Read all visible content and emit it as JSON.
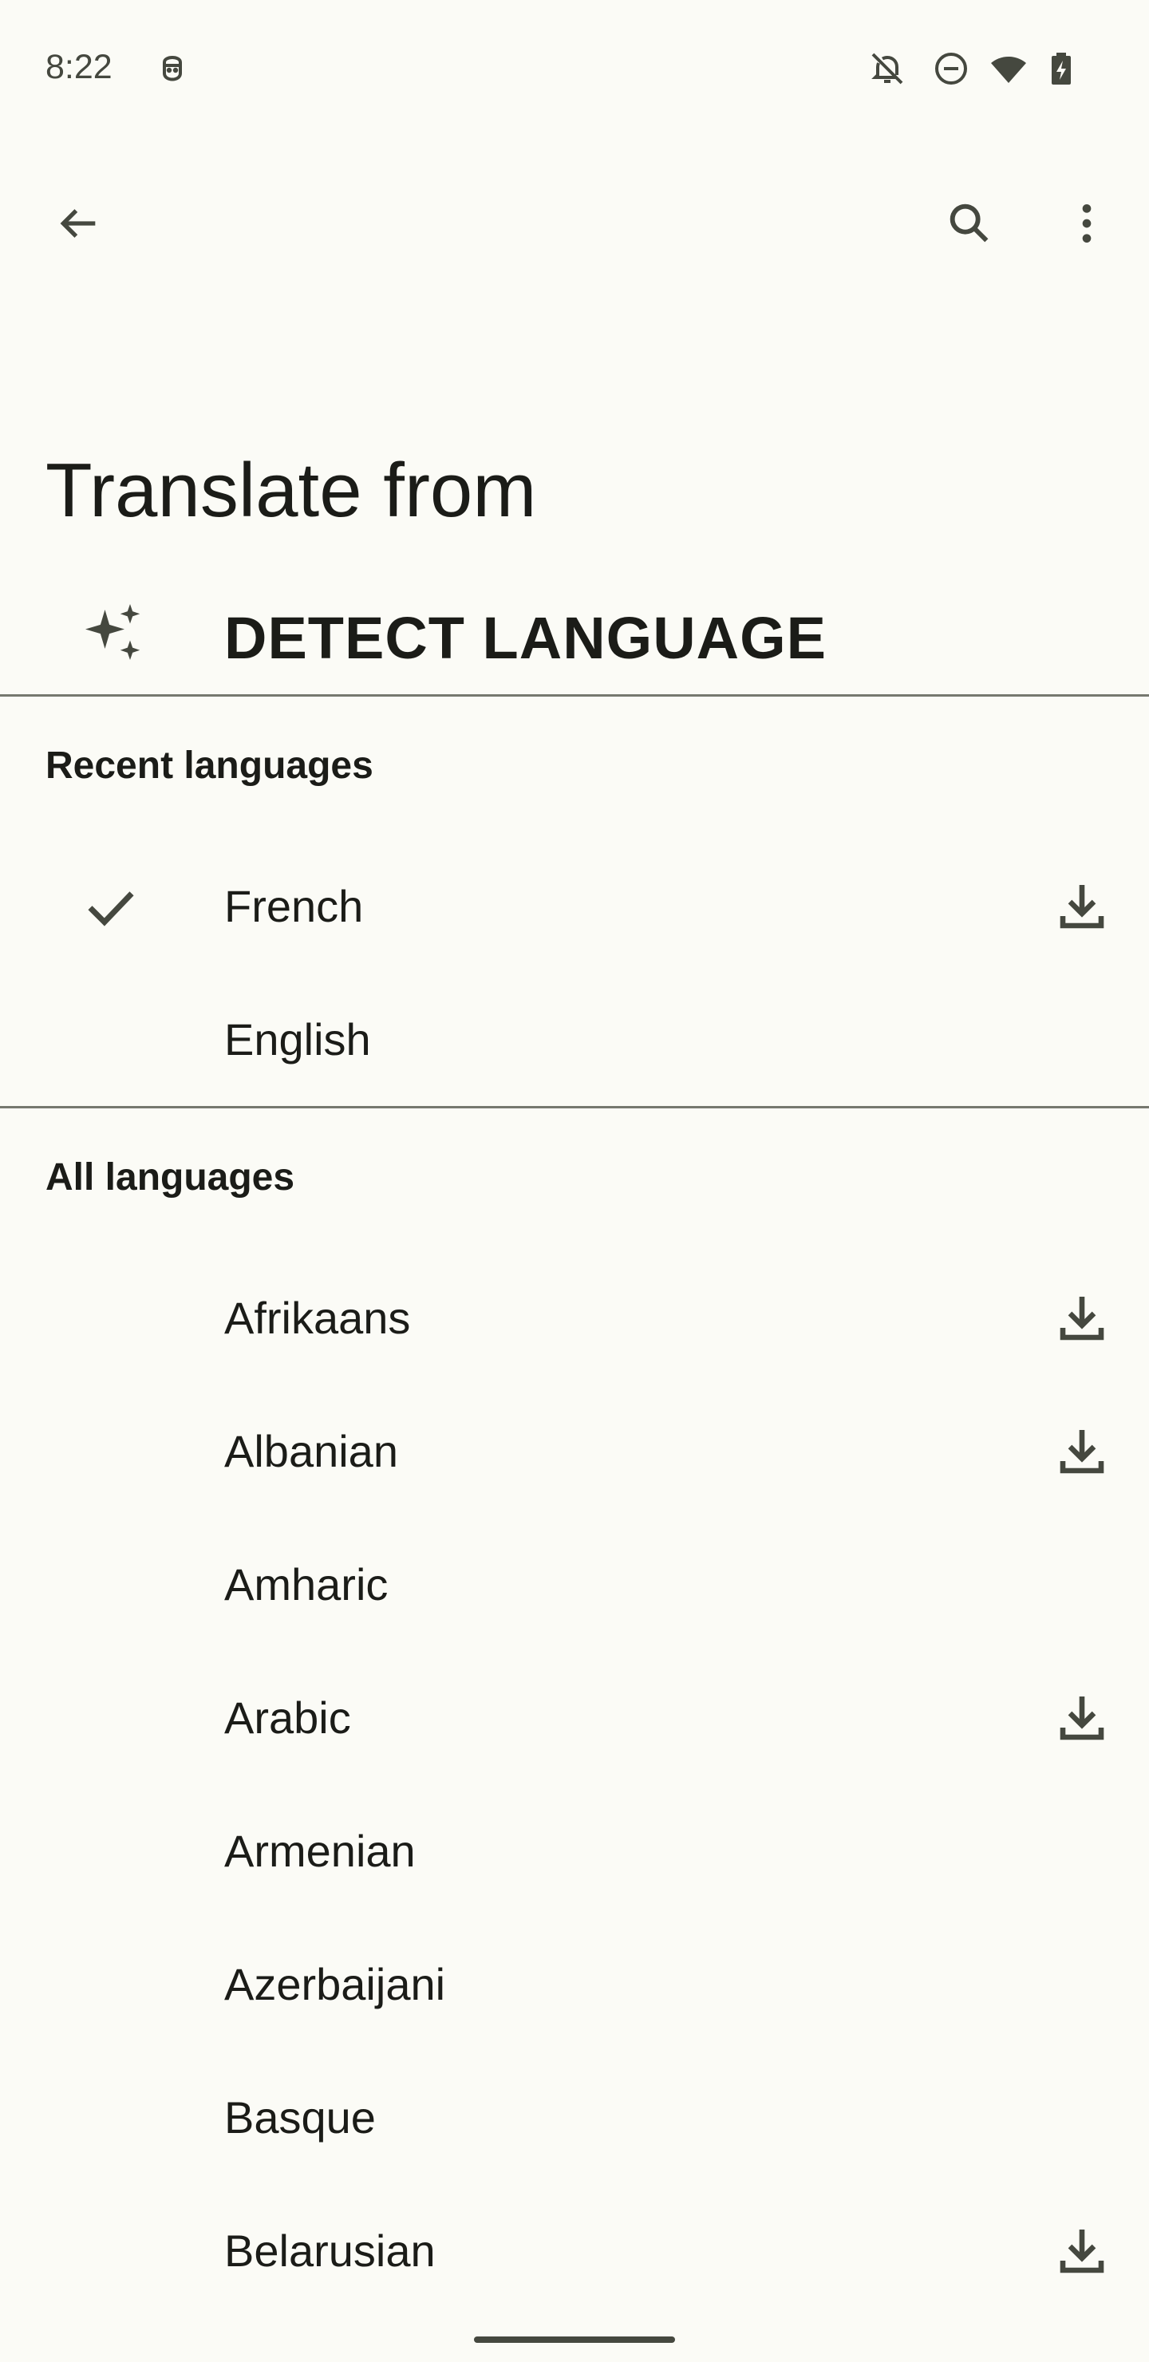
{
  "status_bar": {
    "time": "8:22",
    "icons": [
      "assistant-face-icon",
      "bell-off-icon",
      "do-not-disturb-icon",
      "wifi-icon",
      "battery-charging-icon"
    ]
  },
  "app_bar": {
    "icons": [
      "back-arrow-icon",
      "search-icon",
      "more-vert-icon"
    ]
  },
  "page": {
    "title": "Translate from",
    "detect_language": "DETECT LANGUAGE"
  },
  "recent": {
    "header": "Recent languages",
    "items": [
      {
        "name": "French",
        "selected": true,
        "downloadable": true
      },
      {
        "name": "English",
        "selected": false,
        "downloadable": false
      }
    ]
  },
  "all": {
    "header": "All languages",
    "items": [
      {
        "name": "Afrikaans",
        "downloadable": true
      },
      {
        "name": "Albanian",
        "downloadable": true
      },
      {
        "name": "Amharic",
        "downloadable": false
      },
      {
        "name": "Arabic",
        "downloadable": true
      },
      {
        "name": "Armenian",
        "downloadable": false
      },
      {
        "name": "Azerbaijani",
        "downloadable": false
      },
      {
        "name": "Basque",
        "downloadable": false
      },
      {
        "name": "Belarusian",
        "downloadable": true
      }
    ]
  },
  "colors": {
    "background": "#fbfbf6",
    "text": "#1b1c18",
    "icon": "#45483f",
    "divider": "#76786f"
  }
}
